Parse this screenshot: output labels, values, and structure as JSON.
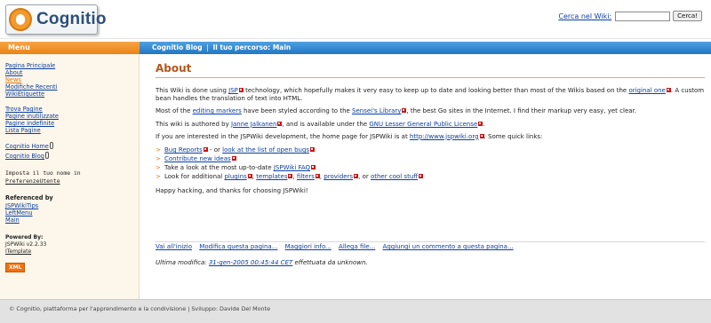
{
  "header": {
    "logo_text": "Cognitio",
    "search_label": "Cerca nel Wiki:",
    "search_value": "",
    "search_button": "Cerca!"
  },
  "menu": {
    "title": "Menu",
    "group1": [
      "Pagina Principale",
      "About",
      "News",
      "Modifiche Recenti",
      "WikiEtiquette"
    ],
    "group2": [
      "Trova Pagine",
      "Pagine inutilizzate",
      "Pagine indefinite",
      "Lista Pagine"
    ],
    "group3": [
      "Cognitio Home",
      "Cognitio Blog"
    ],
    "pref_text": "Imposta il tuo nome in",
    "pref_link": "PreferenzeUtente",
    "referenced_title": "Referenced by",
    "referenced": [
      "JSPWikiTips",
      "LeftMenu",
      "Main"
    ],
    "powered_title": "Powered By:",
    "powered_version": "JSPWiki v2.2.33",
    "template_link": "ITemplate",
    "xml_badge": "XML"
  },
  "bar": {
    "blog": "Cognitio Blog",
    "sep": "|",
    "path_label": "Il tuo percorso:",
    "current": "Main"
  },
  "page": {
    "title": "About",
    "p1": {
      "a": "This Wiki is done using ",
      "jsp": "JSP",
      "b": " technology, which hopefully makes it very easy to keep up to date and looking better than most of the Wikis based on the ",
      "orig": "original one",
      "c": ". A custom bean handles the translation of text into HTML."
    },
    "p2": {
      "a": "Most of the ",
      "markers": "editing markers",
      "b": " have been styled according to the ",
      "sensei": "Sensei's Library",
      "c": ", the best Go sites in the Internet. I find their markup very easy, yet clear."
    },
    "p3": {
      "a": "This wiki is authored by ",
      "author": "Janne Jalkanen",
      "b": ", and is available under the ",
      "license": "GNU Lesser General Public License",
      "c": "."
    },
    "p4": {
      "a": "If you are interested in the JSPWiki development, the home page for JSPWiki is at ",
      "url": "http://www.jspwiki.org",
      "b": ". Some quick links:"
    },
    "links": {
      "l1_a": "Bug Reports",
      "l1_b": " - or ",
      "l1_c": "look at the list of open bugs",
      "l2": "Contribute new ideas",
      "l3_a": "Take a look at the most up-to-date ",
      "l3_b": "JSPWiki FAQ",
      "l4_a": "Look for additional ",
      "l4_plugins": "plugins",
      "l4_templates": "templates",
      "l4_filters": "filters",
      "l4_providers": "providers",
      "l4_b": ", or ",
      "l4_cool": "other cool stuff",
      "comma": ", ",
      "bullet": ">"
    },
    "closing": "Happy hacking, and thanks for choosing JSPWiki!"
  },
  "actions": [
    "Vai all'inizio",
    "Modifica questa pagina...",
    "Maggiori info...",
    "Allega file...",
    "Aggiungi un commento a questa pagina..."
  ],
  "last_modified": {
    "prefix": "Ultima modifica: ",
    "date": "31-gen-2005 00:45:44 CET",
    "suffix": " effettuata da unknown."
  },
  "footer": "© Cognitio, piattaforma per l'apprendimento e la condivisione | Sviluppo: Davide Del Monte"
}
